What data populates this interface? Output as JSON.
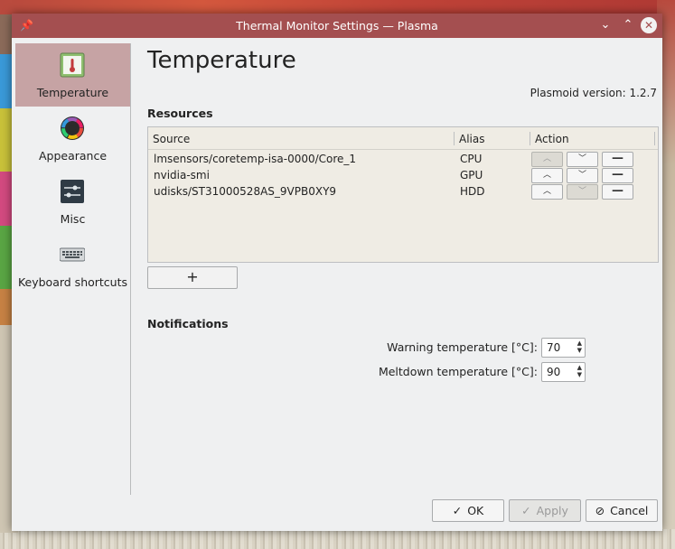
{
  "window": {
    "title": "Thermal Monitor Settings — Plasma",
    "pin_glyph": "📌",
    "min_glyph": "⌄",
    "max_glyph": "⌃",
    "close_glyph": "✕"
  },
  "sidebar": {
    "items": [
      {
        "label": "Temperature",
        "icon": "thermometer-icon",
        "active": true
      },
      {
        "label": "Appearance",
        "icon": "color-wheel-icon",
        "active": false
      },
      {
        "label": "Misc",
        "icon": "sliders-icon",
        "active": false
      },
      {
        "label": "Keyboard shortcuts",
        "icon": "keyboard-icon",
        "active": false
      }
    ]
  },
  "page": {
    "title": "Temperature",
    "version": "Plasmoid version: 1.2.7"
  },
  "resources": {
    "heading": "Resources",
    "columns": [
      "Source",
      "Alias",
      "Action"
    ],
    "rows": [
      {
        "source": "lmsensors/coretemp-isa-0000/Core_1",
        "alias": "CPU",
        "up_enabled": false,
        "down_enabled": true
      },
      {
        "source": "nvidia-smi",
        "alias": "GPU",
        "up_enabled": true,
        "down_enabled": true
      },
      {
        "source": "udisks/ST31000528AS_9VPB0XY9",
        "alias": "HDD",
        "up_enabled": true,
        "down_enabled": false
      }
    ],
    "up_glyph": "︿",
    "down_glyph": "﹀",
    "remove_glyph": "—",
    "add_label": "+"
  },
  "notifications": {
    "heading": "Notifications",
    "warning_label": "Warning temperature [°C]:",
    "warning_value": "70",
    "meltdown_label": "Meltdown temperature [°C]:",
    "meltdown_value": "90"
  },
  "footer": {
    "ok_label": "OK",
    "apply_label": "Apply",
    "cancel_label": "Cancel",
    "check_glyph": "✓",
    "cancel_glyph": "⊘"
  },
  "colors": {
    "titlebar": "#a44f50",
    "active_item": "#c6a3a4",
    "window_bg": "#eff0f1"
  }
}
